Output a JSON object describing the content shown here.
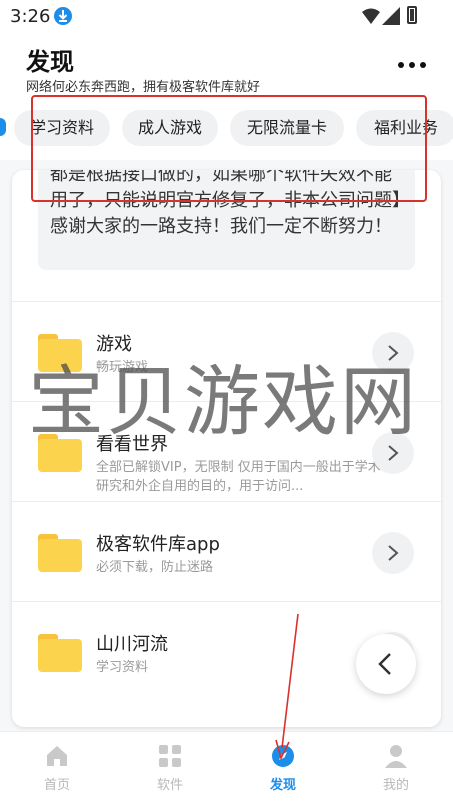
{
  "status": {
    "time": "3:26"
  },
  "header": {
    "title": "发现",
    "subtitle": "网络何必东奔西跑，拥有极客软件库就好"
  },
  "chips": [
    "学习资料",
    "成人游戏",
    "无限流量卡",
    "福利业务"
  ],
  "notice": "都是根据接口做的，如果哪个软件失效不能用了，只能说明官方修复了，非本公司问题】感谢大家的一路支持！我们一定不断努力！",
  "list": [
    {
      "title": "游戏",
      "desc": "畅玩游戏"
    },
    {
      "title": "看看世界",
      "desc": "全部已解锁VIP，无限制 仅用于国内一般出于学术研究和外企自用的目的，用于访问..."
    },
    {
      "title": "极客软件库app",
      "desc": "必须下载，防止迷路"
    },
    {
      "title": "山川河流",
      "desc": "学习资料"
    }
  ],
  "watermark": "宝贝游戏网",
  "nav": [
    {
      "label": "首页",
      "icon": "home-icon"
    },
    {
      "label": "软件",
      "icon": "grid-icon"
    },
    {
      "label": "发现",
      "icon": "compass-icon"
    },
    {
      "label": "我的",
      "icon": "user-icon"
    }
  ],
  "colors": {
    "accent": "#1c8eea",
    "folder": "#fcd34d",
    "annotation": "#d8322c"
  }
}
